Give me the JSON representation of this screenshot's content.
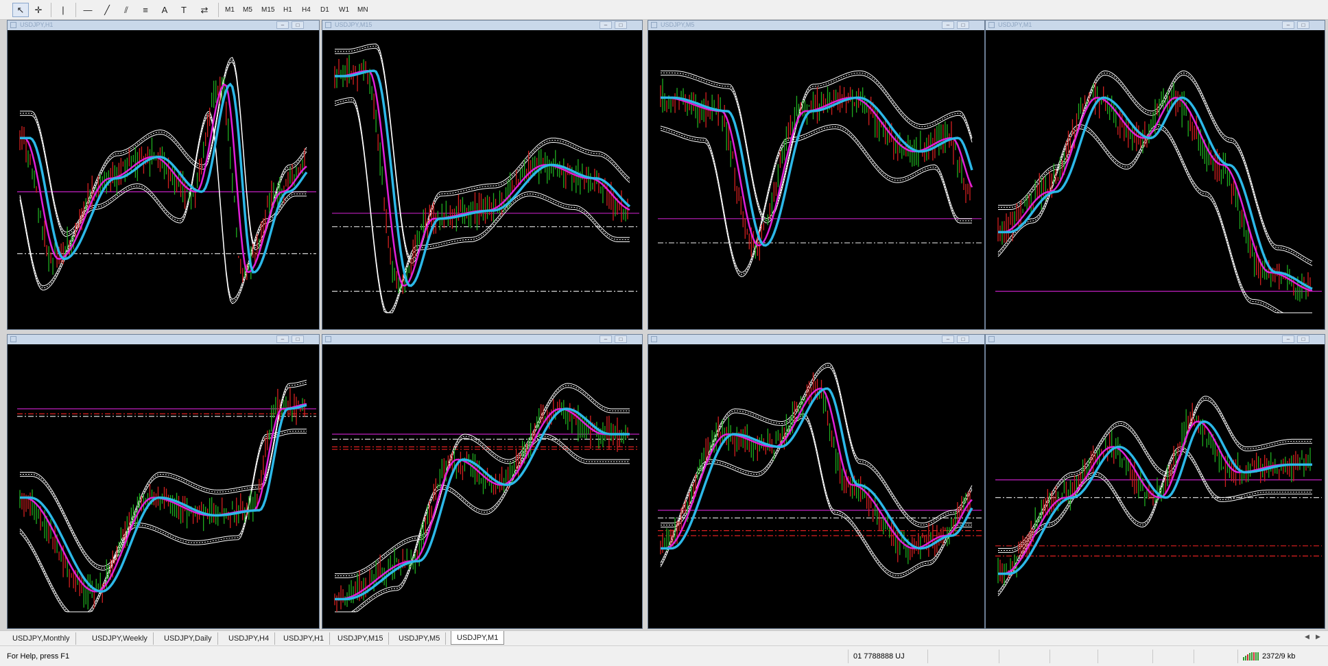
{
  "toolbar": {
    "tools": [
      {
        "icon": "cursor-arrow-icon",
        "glyph": "↖"
      },
      {
        "icon": "crosshair-icon",
        "glyph": "✛"
      },
      {
        "icon": "vertical-line-icon",
        "glyph": "|"
      },
      {
        "icon": "horizontal-line-icon",
        "glyph": "—"
      },
      {
        "icon": "trendline-icon",
        "glyph": "╱"
      },
      {
        "icon": "equidistant-channel-icon",
        "glyph": "⫽"
      },
      {
        "icon": "fibonacci-retracement-icon",
        "glyph": "≡"
      },
      {
        "icon": "text-icon",
        "glyph": "A"
      },
      {
        "icon": "text-label-icon",
        "glyph": "T"
      },
      {
        "icon": "arrows-dropdown-icon",
        "glyph": "⇄"
      }
    ],
    "timeframes": [
      "M1",
      "M5",
      "M15",
      "H1",
      "H4",
      "D1",
      "W1",
      "MN"
    ]
  },
  "charts": [
    {
      "title": "USDJPY,H1"
    },
    {
      "title": "USDJPY,M15"
    },
    {
      "title": "USDJPY,M5"
    },
    {
      "title": "USDJPY,M1"
    },
    {
      "title": ""
    },
    {
      "title": ""
    },
    {
      "title": ""
    },
    {
      "title": ""
    }
  ],
  "colors": {
    "chart_bg": "#000000",
    "bull_candle": "#1fae1f",
    "bear_candle": "#d42020",
    "ma_fast": "#e020d8",
    "ma_slow": "#2cb8e8",
    "envelope": "#ffffff",
    "level_magenta": "#c020c0",
    "level_red": "#e02020",
    "level_white": "#d8d8d8"
  },
  "tabs": [
    "USDJPY,Monthly",
    "USDJPY,Weekly",
    "USDJPY,Daily",
    "USDJPY,H4",
    "USDJPY,H1",
    "USDJPY,M15",
    "USDJPY,M5",
    "USDJPY,M1"
  ],
  "active_tab": "USDJPY,M1",
  "status": {
    "help": "For Help, press F1",
    "profile": "01 7788888 UJ",
    "traffic": "2372/9 kb"
  }
}
